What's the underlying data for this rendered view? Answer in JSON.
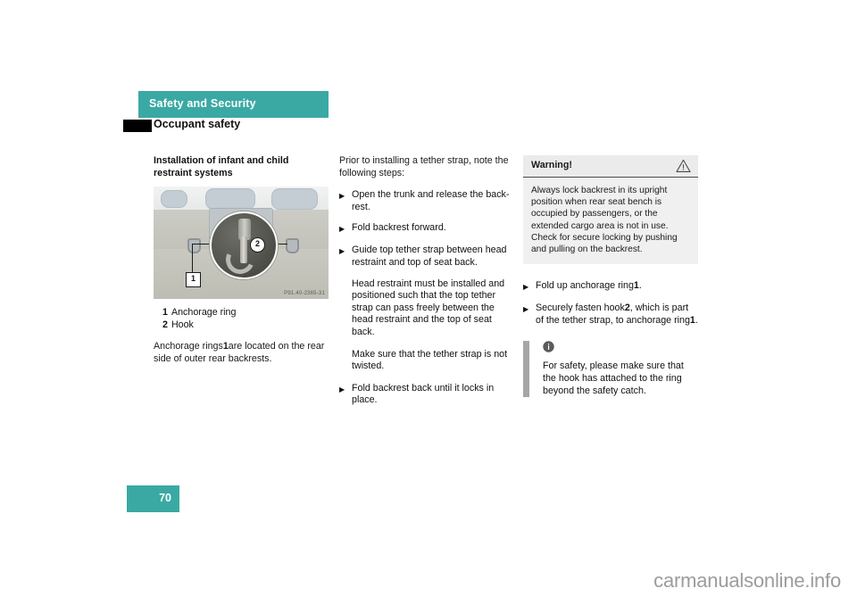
{
  "header": {
    "chapter_title": "Safety and Security",
    "section_title": "Occupant safety",
    "accent_color": "#3aa9a3",
    "tab_color": "#000000"
  },
  "left_column": {
    "heading": "Installation of infant and child restraint systems",
    "figure": {
      "code": "P91.40-2365-31",
      "callout_2": "2",
      "callout_1": "1",
      "alt": "Rear deck of vehicle showing anchorage rings and tether hook detail"
    },
    "legend": [
      {
        "number": "1",
        "label": "Anchorage ring"
      },
      {
        "number": "2",
        "label": "Hook"
      }
    ],
    "paragraph": "Anchorage rings 1 are located on the rear side of outer rear backrests.",
    "paragraph_parts": {
      "a": "Anchorage rings",
      "ref": "1",
      "b": "are located on the rear side of outer rear backrests."
    }
  },
  "middle_column": {
    "intro": "Prior to installing a tether strap, note the following steps:",
    "bullets": [
      "Open the trunk and release the back-rest.",
      "Fold backrest forward.",
      "Guide top tether strap between head restraint and top of seat back."
    ],
    "notes": [
      "Head restraint must be installed and positioned such that the top tether strap can pass freely between the head restraint and the top of seat back.",
      "Make sure that the tether strap is not twisted."
    ],
    "final_bullet": "Fold backrest back until it locks in place.",
    "bullet_mark": "▶"
  },
  "right_column": {
    "warning": {
      "label": "Warning!",
      "icon": "warning-triangle-icon",
      "body": "Always lock backrest in its upright position when rear seat bench is occupied by passengers, or the extended cargo area is not in use. Check for secure locking by pushing and pulling on the backrest.",
      "header_bg": "#ebebeb",
      "body_bg": "#f0f0f0"
    },
    "bullets": [
      {
        "parts": {
          "a": "Fold up anchorage ring",
          "ref1": "1",
          "b": ".",
          "ref2": "",
          "c": ""
        },
        "text": "Fold up anchorage ring 1."
      },
      {
        "parts": {
          "a": "Securely fasten hook",
          "ref1": "2",
          "b": ", which is part of the tether strap, to anchorage ring",
          "ref2": "1",
          "c": "."
        },
        "text": "Securely fasten hook 2, which is part of the tether strap, to anchorage ring 1."
      }
    ],
    "info_note": {
      "icon": "info-circle-icon",
      "text": "For safety, please make sure that the hook has attached to the ring beyond the safety catch.",
      "bar_color": "#a6a6a6"
    },
    "bullet_mark": "▶"
  },
  "footer": {
    "page_number": "70",
    "watermark": "carmanualsonline.info"
  }
}
